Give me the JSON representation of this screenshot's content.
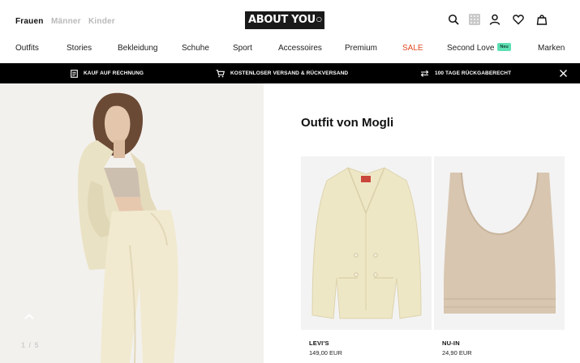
{
  "header": {
    "genders": [
      "Frauen",
      "Männer",
      "Kinder"
    ],
    "logo": "ABOUT YOU",
    "icons": [
      "search-icon",
      "grid-icon",
      "user-icon",
      "heart-icon",
      "bag-icon"
    ]
  },
  "nav": {
    "items": [
      "Outfits",
      "Stories",
      "Bekleidung",
      "Schuhe",
      "Sport",
      "Accessoires",
      "Premium",
      "SALE",
      "Second Love",
      "Marken"
    ],
    "neu_badge": "Neu"
  },
  "promo": {
    "items": [
      "KAUF AUF RECHNUNG",
      "KOSTENLOSER VERSAND & RÜCKVERSAND",
      "100 TAGE RÜCKGABERECHT"
    ]
  },
  "gallery": {
    "counter": "1 / 5"
  },
  "outfit": {
    "title": "Outfit von Mogli",
    "products": [
      {
        "brand": "LEVI'S",
        "price": "149,00 EUR"
      },
      {
        "brand": "NU-IN",
        "price": "24,90 EUR"
      }
    ]
  },
  "colors": {
    "sale": "#e04b22",
    "neu_badge": "#5ee0b4",
    "promo_bar": "#000000",
    "blazer": "#eee7c6",
    "knit_top": "#d8c6b0"
  }
}
